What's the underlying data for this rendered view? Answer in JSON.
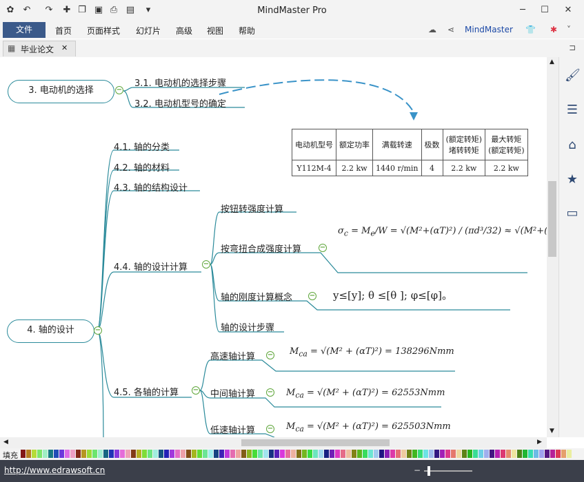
{
  "titlebar": {
    "title": "MindMaster Pro",
    "qa_icons": [
      "app-logo-icon",
      "undo-icon",
      "redo-icon",
      "new-icon",
      "open-icon",
      "save-icon",
      "print-icon",
      "export-icon",
      "more-icon"
    ],
    "controls": [
      "─",
      "☐",
      "✕"
    ]
  },
  "menubar": {
    "file": "文件",
    "items": [
      "首页",
      "页面样式",
      "幻灯片",
      "高级",
      "视图",
      "帮助"
    ],
    "brand": "MindMaster"
  },
  "tab": {
    "label": "毕业论文",
    "close": "✕"
  },
  "mindmap": {
    "topic3": "3. 电动机的选择",
    "sub3_1": "3.1. 电动机的选择步骤",
    "sub3_2": "3.2. 电动机型号的确定",
    "topic4": "4. 轴的设计",
    "sub4_1": "4.1. 轴的分类",
    "sub4_2": "4.2. 轴的材料",
    "sub4_3": "4.3. 轴的结构设计",
    "sub4_4": "4.4. 轴的设计计算",
    "sub4_4_1": "按钮转强度计算",
    "sub4_4_2": "按弯扭合成强度计算",
    "sub4_4_3": "轴的刚度计算概念",
    "sub4_4_4": "轴的设计步骤",
    "sub4_5": "4.5. 各轴的计算",
    "sub4_5_1": "高速轴计算",
    "sub4_5_2": "中间轴计算",
    "sub4_5_3": "低速轴计算",
    "stiffness": "y≤[y];      θ ≤[θ ];    φ≤[φ]。",
    "m_high": "= 138296Nmm",
    "m_mid": "= 62553Nmm",
    "m_low": "= 625503Nmm"
  },
  "table": {
    "headers": [
      "电动机型号",
      "额定功率",
      "满载转速",
      "极数",
      "(额定转矩)\n堵转转矩",
      "最大转矩\n(额定转矩)"
    ],
    "row": [
      "Y112M-4",
      "2.2 kw",
      "1440 r/min",
      "4",
      "2.2 kw",
      "2.2 kw"
    ]
  },
  "palette_label": "填充",
  "status": {
    "url": "http://www.edrawsoft.cn"
  },
  "colors": {
    "branch": "#2a8a9a",
    "accent": "#3b5a8a",
    "arrow": "#3a93c8",
    "collapse": "#5ea63a"
  }
}
